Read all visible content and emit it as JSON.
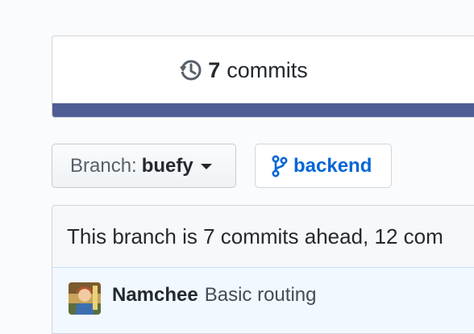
{
  "summary": {
    "commit_count": "7",
    "commit_label": "commits",
    "bar_color": "#4f5d95"
  },
  "branch_select": {
    "prefix": "Branch:",
    "value": "buefy"
  },
  "compare_branch": {
    "label": "backend",
    "color": "#0366d6"
  },
  "comparison": {
    "ahead_text": "This branch is 7 commits ahead, 12 com"
  },
  "commits": [
    {
      "author": "Namchee",
      "message": "Basic routing"
    }
  ]
}
